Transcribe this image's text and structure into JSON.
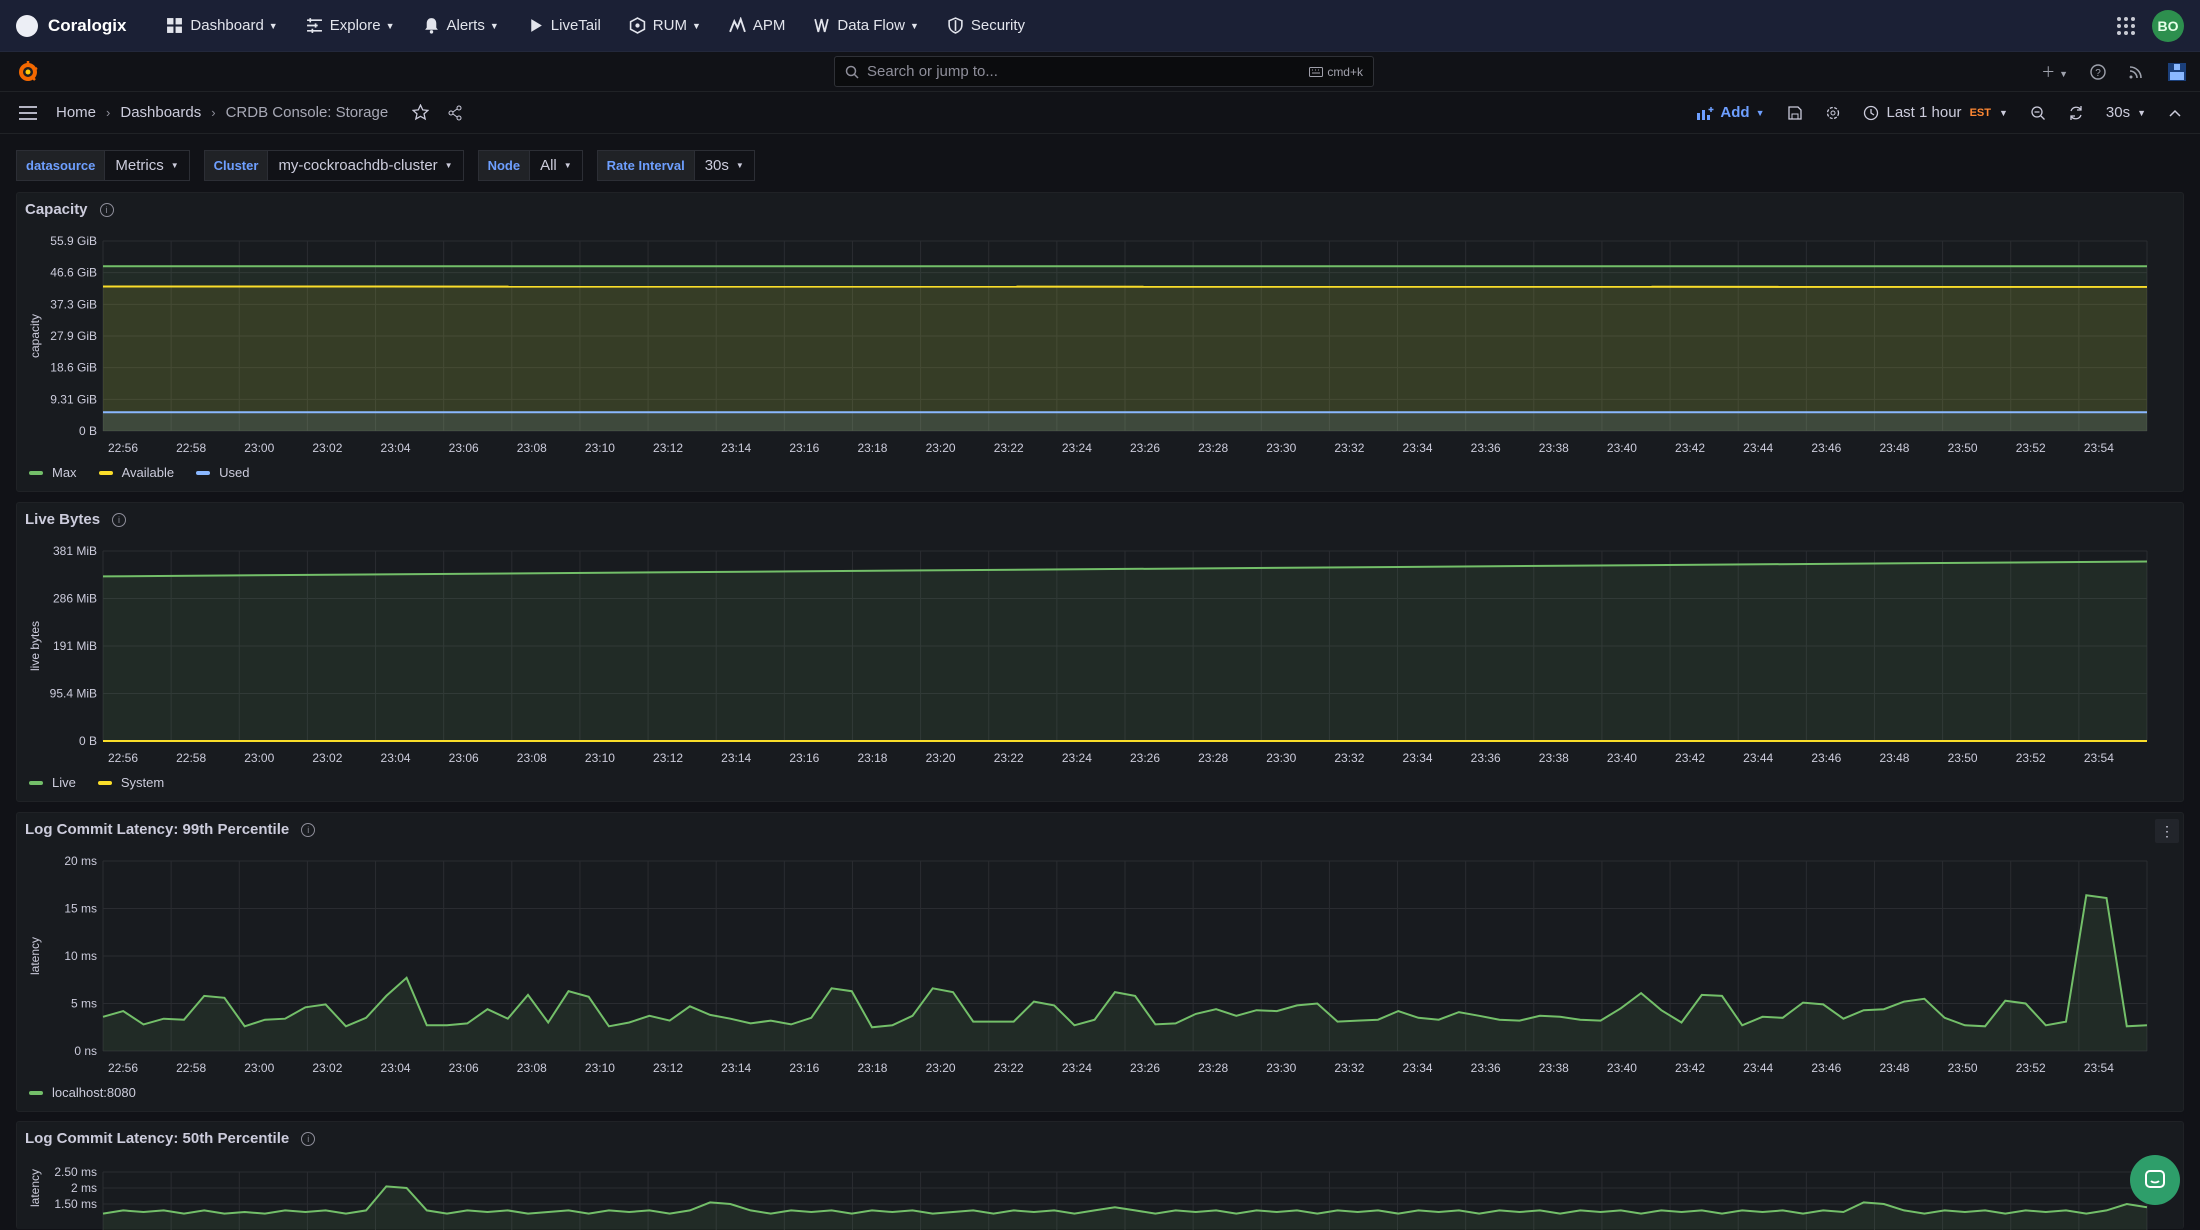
{
  "topnav": {
    "brand": "Coralogix",
    "items": [
      {
        "label": "Dashboard",
        "icon": "dashboard-grid-icon",
        "caret": true
      },
      {
        "label": "Explore",
        "icon": "explore-icon",
        "caret": true
      },
      {
        "label": "Alerts",
        "icon": "bell-icon",
        "caret": true
      },
      {
        "label": "LiveTail",
        "icon": "play-icon",
        "caret": false
      },
      {
        "label": "RUM",
        "icon": "rum-icon",
        "caret": true
      },
      {
        "label": "APM",
        "icon": "apm-icon",
        "caret": false
      },
      {
        "label": "Data Flow",
        "icon": "data-flow-icon",
        "caret": true
      },
      {
        "label": "Security",
        "icon": "shield-icon",
        "caret": false
      }
    ],
    "avatar": "BO"
  },
  "search": {
    "placeholder": "Search or jump to...",
    "shortcut": "cmd+k"
  },
  "breadcrumb": {
    "home": "Home",
    "dashboards": "Dashboards",
    "current": "CRDB Console: Storage"
  },
  "toolbar": {
    "add_label": "Add",
    "time_range": "Last 1 hour",
    "timezone": "EST",
    "refresh": "30s"
  },
  "variables": [
    {
      "label": "datasource",
      "value": "Metrics"
    },
    {
      "label": "Cluster",
      "value": "my-cockroachdb-cluster"
    },
    {
      "label": "Node",
      "value": "All"
    },
    {
      "label": "Rate Interval",
      "value": "30s"
    }
  ],
  "colors": {
    "green": "#73bf69",
    "yellow": "#fade2a",
    "blue": "#8ab8ff"
  },
  "chart_data": [
    {
      "type": "area",
      "title": "Capacity",
      "ylabel": "capacity",
      "yticks": [
        "55.9 GiB",
        "46.6 GiB",
        "37.3 GiB",
        "27.9 GiB",
        "18.6 GiB",
        "9.31 GiB",
        "0 B"
      ],
      "ylim": [
        0,
        55.9
      ],
      "xticks": [
        "22:56",
        "22:58",
        "23:00",
        "23:02",
        "23:04",
        "23:06",
        "23:08",
        "23:10",
        "23:12",
        "23:14",
        "23:16",
        "23:18",
        "23:20",
        "23:22",
        "23:24",
        "23:26",
        "23:28",
        "23:30",
        "23:32",
        "23:34",
        "23:36",
        "23:38",
        "23:40",
        "23:42",
        "23:44",
        "23:46",
        "23:48",
        "23:50",
        "23:52",
        "23:54"
      ],
      "series": [
        {
          "name": "Max",
          "color": "#73bf69",
          "values": [
            48.5,
            48.5
          ]
        },
        {
          "name": "Available",
          "color": "#fade2a",
          "values": [
            42.5,
            42.4
          ]
        },
        {
          "name": "Used",
          "color": "#8ab8ff",
          "values": [
            5.5,
            5.5
          ]
        }
      ]
    },
    {
      "type": "area",
      "title": "Live Bytes",
      "ylabel": "live bytes",
      "yticks": [
        "381 MiB",
        "286 MiB",
        "191 MiB",
        "95.4 MiB",
        "0 B"
      ],
      "ylim": [
        0,
        381
      ],
      "xticks": [
        "22:56",
        "22:58",
        "23:00",
        "23:02",
        "23:04",
        "23:06",
        "23:08",
        "23:10",
        "23:12",
        "23:14",
        "23:16",
        "23:18",
        "23:20",
        "23:22",
        "23:24",
        "23:26",
        "23:28",
        "23:30",
        "23:32",
        "23:34",
        "23:36",
        "23:38",
        "23:40",
        "23:42",
        "23:44",
        "23:46",
        "23:48",
        "23:50",
        "23:52",
        "23:54"
      ],
      "series": [
        {
          "name": "Live",
          "color": "#73bf69",
          "values": [
            330,
            360
          ]
        },
        {
          "name": "System",
          "color": "#fade2a",
          "values": [
            0,
            0
          ]
        }
      ]
    },
    {
      "type": "area",
      "title": "Log Commit Latency: 99th Percentile",
      "ylabel": "latency",
      "yticks": [
        "20 ms",
        "15 ms",
        "10 ms",
        "5 ms",
        "0 ns"
      ],
      "ylim": [
        0,
        20
      ],
      "xticks": [
        "22:56",
        "22:58",
        "23:00",
        "23:02",
        "23:04",
        "23:06",
        "23:08",
        "23:10",
        "23:12",
        "23:14",
        "23:16",
        "23:18",
        "23:20",
        "23:22",
        "23:24",
        "23:26",
        "23:28",
        "23:30",
        "23:32",
        "23:34",
        "23:36",
        "23:38",
        "23:40",
        "23:42",
        "23:44",
        "23:46",
        "23:48",
        "23:50",
        "23:52",
        "23:54"
      ],
      "series": [
        {
          "name": "localhost:8080",
          "color": "#73bf69",
          "values": [
            3.6,
            4.2,
            2.8,
            3.4,
            3.3,
            5.8,
            5.6,
            2.6,
            3.3,
            3.4,
            4.6,
            4.9,
            2.6,
            3.5,
            5.8,
            7.7,
            2.7,
            2.7,
            2.9,
            4.4,
            3.4,
            5.9,
            3.0,
            6.3,
            5.7,
            2.6,
            3.0,
            3.7,
            3.2,
            4.7,
            3.8,
            3.4,
            2.9,
            3.2,
            2.8,
            3.5,
            6.6,
            6.3,
            2.5,
            2.7,
            3.7,
            6.6,
            6.2,
            3.1,
            3.1,
            3.1,
            5.2,
            4.8,
            2.7,
            3.3,
            6.2,
            5.8,
            2.8,
            2.9,
            3.9,
            4.4,
            3.7,
            4.3,
            4.2,
            4.8,
            5.0,
            3.1,
            3.2,
            3.3,
            4.2,
            3.5,
            3.3,
            4.1,
            3.7,
            3.3,
            3.2,
            3.7,
            3.6,
            3.3,
            3.2,
            4.5,
            6.1,
            4.3,
            3.0,
            5.9,
            5.8,
            2.7,
            3.6,
            3.5,
            5.1,
            4.9,
            3.4,
            4.3,
            4.4,
            5.2,
            5.5,
            3.5,
            2.7,
            2.6,
            5.3,
            5.0,
            2.7,
            3.1,
            16.4,
            16.1,
            2.6,
            2.7
          ]
        }
      ]
    },
    {
      "type": "area",
      "title": "Log Commit Latency: 50th Percentile",
      "ylabel": "latency",
      "yticks": [
        "2.50 ms",
        "2 ms",
        "1.50 ms"
      ],
      "xticks": [],
      "series": [
        {
          "name": "localhost:8080",
          "color": "#73bf69",
          "values": [
            1.2,
            1.3,
            1.25,
            1.3,
            1.2,
            1.3,
            1.2,
            1.25,
            1.2,
            1.3,
            1.25,
            1.3,
            1.2,
            1.3,
            2.05,
            2.0,
            1.3,
            1.2,
            1.3,
            1.25,
            1.3,
            1.2,
            1.25,
            1.3,
            1.2,
            1.3,
            1.25,
            1.3,
            1.2,
            1.3,
            1.55,
            1.5,
            1.3,
            1.2,
            1.3,
            1.25,
            1.3,
            1.2,
            1.3,
            1.25,
            1.3,
            1.2,
            1.25,
            1.3,
            1.2,
            1.3,
            1.25,
            1.3,
            1.2,
            1.3,
            1.4,
            1.3,
            1.2,
            1.3,
            1.25,
            1.3,
            1.2,
            1.3,
            1.25,
            1.3,
            1.2,
            1.3,
            1.25,
            1.3,
            1.2,
            1.3,
            1.25,
            1.3,
            1.2,
            1.3,
            1.25,
            1.3,
            1.2,
            1.3,
            1.25,
            1.3,
            1.2,
            1.3,
            1.25,
            1.3,
            1.2,
            1.3,
            1.25,
            1.3,
            1.2,
            1.3,
            1.25,
            1.55,
            1.5,
            1.3,
            1.2,
            1.3,
            1.25,
            1.3,
            1.2,
            1.3,
            1.25,
            1.3,
            1.2,
            1.3,
            1.5,
            1.4
          ]
        }
      ]
    }
  ]
}
